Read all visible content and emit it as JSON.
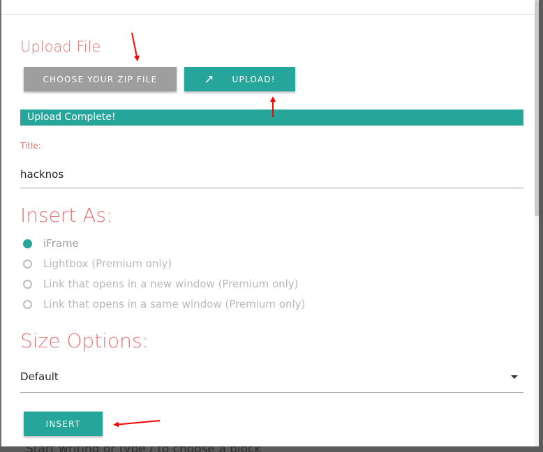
{
  "upload": {
    "title": "Upload File",
    "choose_label": "CHOOSE YOUR ZIP FILE",
    "upload_label": "UPLOAD!",
    "upload_icon": "↗",
    "progress_text": "Upload Complete!",
    "progress_value": 1.0
  },
  "title_field": {
    "label": "Title:",
    "value": "hacknos"
  },
  "insert_as": {
    "title": "Insert As:",
    "options": [
      {
        "label": "iFrame",
        "selected": true
      },
      {
        "label": "Lightbox (Premium only)",
        "selected": false
      },
      {
        "label": "Link that opens in a new window (Premium only)",
        "selected": false
      },
      {
        "label": "Link that opens in a same window (Premium only)",
        "selected": false
      }
    ]
  },
  "size_options": {
    "title": "Size Options:",
    "selected": "Default"
  },
  "insert_button": {
    "label": "INSERT"
  },
  "background_editor": {
    "placeholder": "Start writing or type / to choose a block"
  },
  "colors": {
    "accent": "#26a69a",
    "heading": "#e57373",
    "annotation_arrow": "#ff0000",
    "disabled_button": "#9e9e9e"
  }
}
